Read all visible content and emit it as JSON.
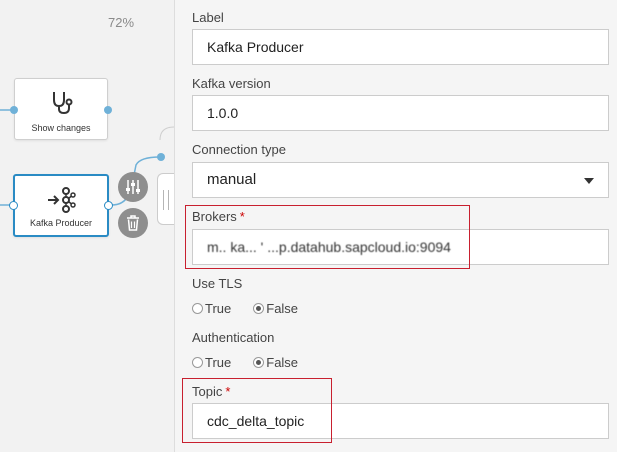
{
  "canvas": {
    "zoom": "72%",
    "nodes": [
      {
        "label": "Show changes",
        "icon": "stethoscope-icon",
        "selected": false
      },
      {
        "label": "Kafka Producer",
        "icon": "kafka-icon",
        "selected": true
      }
    ],
    "actions": [
      {
        "icon": "settings-sliders-icon"
      },
      {
        "icon": "trash-icon"
      }
    ]
  },
  "panel": {
    "label_field": {
      "label": "Label",
      "value": "Kafka Producer"
    },
    "kafka_version": {
      "label": "Kafka version",
      "value": "1.0.0"
    },
    "connection_type": {
      "label": "Connection type",
      "value": "manual"
    },
    "brokers": {
      "label": "Brokers",
      "required": "*",
      "value": "m.. ka... '  ...p.datahub.sapcloud.io:9094"
    },
    "use_tls": {
      "label": "Use TLS",
      "options": [
        "True",
        "False"
      ],
      "selected": "False"
    },
    "authentication": {
      "label": "Authentication",
      "options": [
        "True",
        "False"
      ],
      "selected": "False"
    },
    "topic": {
      "label": "Topic",
      "required": "*",
      "value": "cdc_delta_topic"
    }
  },
  "colors": {
    "selection": "#2a8bc4",
    "highlight": "#c8202f",
    "required": "#cc0000"
  }
}
